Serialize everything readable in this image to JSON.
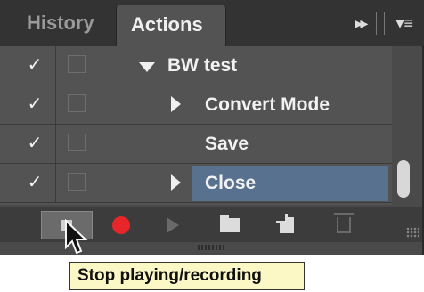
{
  "tabs": {
    "history": "History",
    "actions": "Actions"
  },
  "tab_tools": {
    "collapse_glyph": "▸▸",
    "menu_glyph": "▾≡"
  },
  "rows": [
    {
      "check": "✓",
      "label": "BW test",
      "expand": "down",
      "selected": false
    },
    {
      "check": "✓",
      "label": "Convert Mode",
      "expand": "right",
      "selected": false
    },
    {
      "check": "✓",
      "label": "Save",
      "expand": "none",
      "selected": false
    },
    {
      "check": "✓",
      "label": "Close",
      "expand": "right",
      "selected": true
    }
  ],
  "tooltip": "Stop playing/recording",
  "colors": {
    "selected_row": "#57718f",
    "record": "#e8262a",
    "tooltip_bg": "#fbf8c6"
  },
  "icons": [
    "stop-icon",
    "record-icon",
    "play-icon",
    "new-set-icon",
    "new-action-icon",
    "trash-icon"
  ]
}
